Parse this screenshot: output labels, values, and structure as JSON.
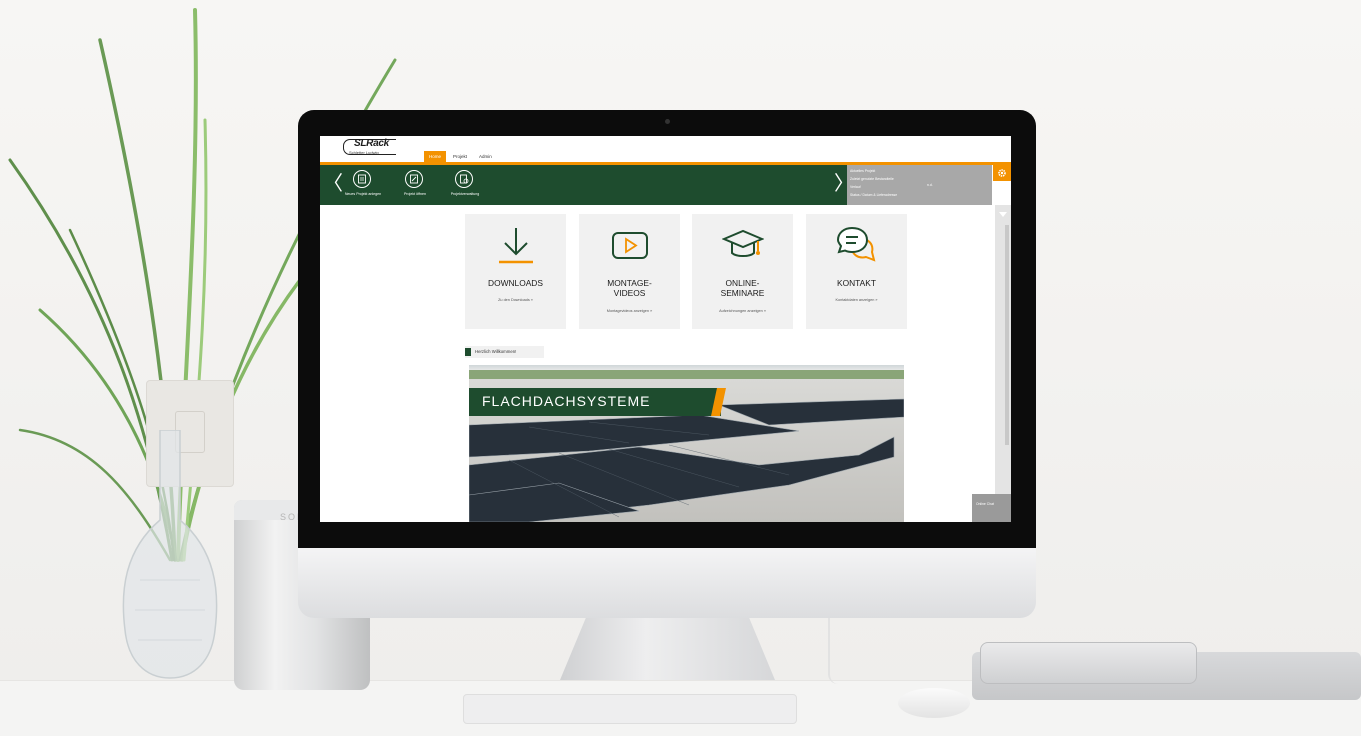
{
  "app": {
    "logo_text": "SLRack",
    "logo_sub": "Schletter Ludwig"
  },
  "nav_tabs": [
    {
      "label": "Home",
      "active": true
    },
    {
      "label": "Projekt",
      "active": false
    },
    {
      "label": "Admin",
      "active": false
    }
  ],
  "ribbon": {
    "buttons": [
      {
        "label": "Neues Projekt anlegen",
        "icon": "new-project-icon"
      },
      {
        "label": "Projekt öffnen",
        "icon": "open-project-icon"
      },
      {
        "label": "Projektverwaltung",
        "icon": "project-management-icon"
      }
    ]
  },
  "recent_projects": {
    "items": [
      "Aktuelles Projekt",
      "Zuletzt genutzte Bestandteile",
      "Verlauf",
      "Status / Datum & Lieferadresse"
    ],
    "value": "n.d."
  },
  "tiles": [
    {
      "title_lines": [
        "DOWNLOADS"
      ],
      "link": "Zu den Downloads »",
      "icon": "download-arrow-icon"
    },
    {
      "title_lines": [
        "MONTAGE-",
        "VIDEOS"
      ],
      "link": "Montagevideos anzeigen »",
      "icon": "play-video-icon"
    },
    {
      "title_lines": [
        "ONLINE-",
        "SEMINARE"
      ],
      "link": "Aufzeichnungen anzeigen »",
      "icon": "graduation-cap-icon"
    },
    {
      "title_lines": [
        "KONTAKT"
      ],
      "link": "Kontaktdaten anzeigen »",
      "icon": "chat-bubbles-icon"
    }
  ],
  "welcome": "Herzlich Willkommen!",
  "banner": {
    "title": "FLACHDACHSYSTEME"
  },
  "chat_button": "Online Chat",
  "speaker_label": "SONOS",
  "colors": {
    "brand_green": "#1e4c2e",
    "accent_orange": "#f39200",
    "gray": "#a8a8a8"
  }
}
